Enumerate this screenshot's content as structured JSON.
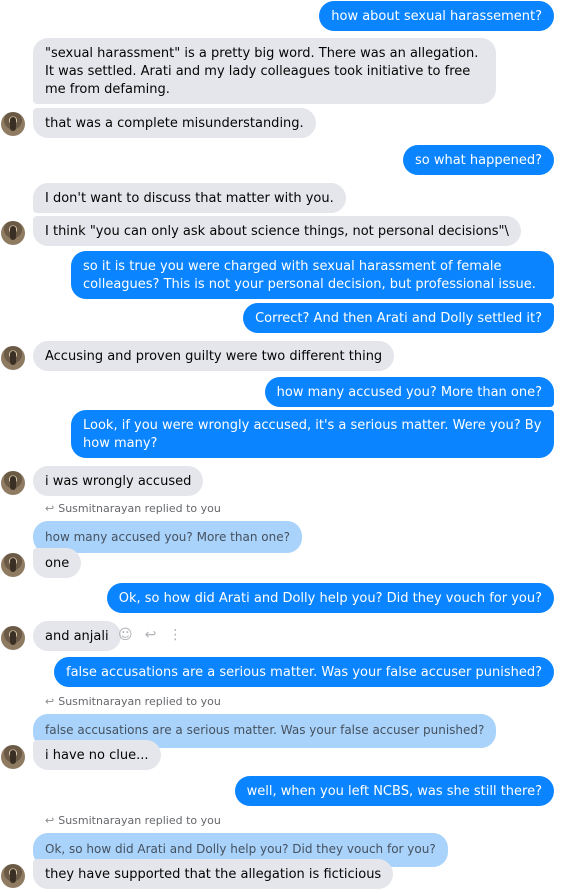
{
  "messages": [
    {
      "text": "how about sexual harassement?"
    },
    {
      "text": "\"sexual harassment\" is a pretty big word. There was an allegation. It was settled. Arati and my lady colleagues took initiative to free me from defaming."
    },
    {
      "text": "that was a complete misunderstanding."
    },
    {
      "text": "so what happened?"
    },
    {
      "text": "I don't want to discuss that matter with you."
    },
    {
      "text": "I think \"you can only ask about science things, not personal decisions\"\\"
    },
    {
      "text": "so it is true you were charged with sexual harassment of female colleagues? This is not your personal decision, but professional issue."
    },
    {
      "text": "Correct? And then Arati and Dolly settled it?"
    },
    {
      "text": "Accusing and proven guilty were two different thing"
    },
    {
      "text": "how many accused you? More than one?"
    },
    {
      "text": "Look, if you were wrongly accused, it's a serious matter. Were you? By how many?"
    },
    {
      "text": "i was wrongly accused"
    },
    {
      "text": "one"
    },
    {
      "text": "Ok, so how did Arati and Dolly help you? Did they vouch for you?"
    },
    {
      "text": "and anjali"
    },
    {
      "text": "false accusations are a serious matter. Was your false accuser punished?"
    },
    {
      "text": "i have no clue..."
    },
    {
      "text": "well, when you left NCBS, was she still there?"
    },
    {
      "text": "they have supported that the allegation is ficticious"
    }
  ],
  "replies": [
    {
      "note": "Susmitnarayan replied to you",
      "quoted": "how many accused you? More than one?"
    },
    {
      "note": "Susmitnarayan replied to you",
      "quoted": "false accusations are a serious matter. Was your false accuser punished?"
    },
    {
      "note": "Susmitnarayan replied to you",
      "quoted": "Ok, so how did Arati and Dolly help you? Did they vouch for you?"
    }
  ],
  "icons": {
    "reply_arrow": "reply-arrow-icon",
    "emoji": "smiley-icon",
    "reply": "reply-icon",
    "more": "more-vertical-icon"
  },
  "colors": {
    "outgoing": "#0a84ff",
    "incoming": "#e4e6eb",
    "quoted": "#a9d3fb"
  }
}
